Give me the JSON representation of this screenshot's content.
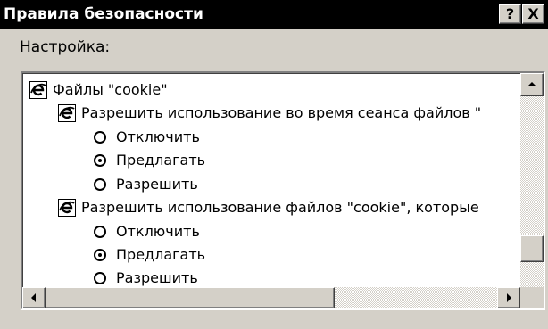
{
  "window": {
    "title": "Правила безопасности",
    "help_button": "?",
    "close_button": "X"
  },
  "settings_label": "Настройка:",
  "tree": {
    "category": {
      "label": "Файлы \"cookie\"",
      "icon": "ie-settings-icon"
    },
    "groups": [
      {
        "label": "Разрешить использование во время сеанса файлов \"",
        "icon": "ie-settings-icon",
        "options": [
          {
            "label": "Отключить",
            "selected": false
          },
          {
            "label": "Предлагать",
            "selected": true
          },
          {
            "label": "Разрешить",
            "selected": false
          }
        ]
      },
      {
        "label": "Разрешить использование файлов \"cookie\",  которые",
        "icon": "ie-settings-icon",
        "options": [
          {
            "label": "Отключить",
            "selected": false
          },
          {
            "label": "Предлагать",
            "selected": true
          },
          {
            "label": "Разрешить",
            "selected": false
          }
        ]
      }
    ]
  },
  "scrollbars": {
    "vertical": {
      "position": 0.85
    },
    "horizontal": {
      "position": 0.0
    }
  },
  "colors": {
    "titlebar": "#000000",
    "face": "#d4d0c8",
    "listbox": "#ffffff"
  }
}
